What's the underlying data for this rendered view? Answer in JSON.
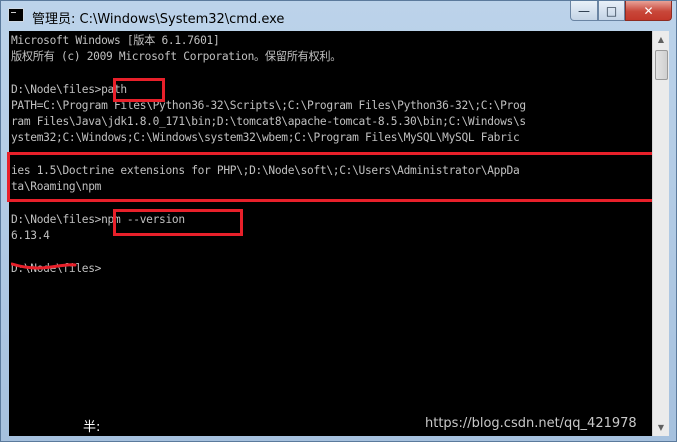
{
  "window": {
    "title": "管理员: C:\\Windows\\System32\\cmd.exe",
    "minimize_glyph": "—",
    "maximize_glyph": "□",
    "close_glyph": "✕"
  },
  "console": {
    "lines": [
      "Microsoft Windows [版本 6.1.7601]",
      "版权所有 (c) 2009 Microsoft Corporation。保留所有权利。",
      "",
      "D:\\Node\\files>path",
      "PATH=C:\\Program Files\\Python36-32\\Scripts\\;C:\\Program Files\\Python36-32\\;C:\\Prog",
      "ram Files\\Java\\jdk1.8.0_171\\bin;D:\\tomcat8\\apache-tomcat-8.5.30\\bin;C:\\Windows\\s",
      "ystem32;C:\\Windows;C:\\Windows\\system32\\wbem;C:\\Program Files\\MySQL\\MySQL Fabric",
      "",
      "ies 1.5\\Doctrine extensions for PHP\\;D:\\Node\\soft\\;C:\\Users\\Administrator\\AppDa",
      "ta\\Roaming\\npm",
      "",
      "D:\\Node\\files>npm --version",
      "6.13.4",
      "",
      "D:\\Node\\files>"
    ]
  },
  "ime_status": "半:",
  "watermark": "https://blog.csdn.net/qq_421978"
}
